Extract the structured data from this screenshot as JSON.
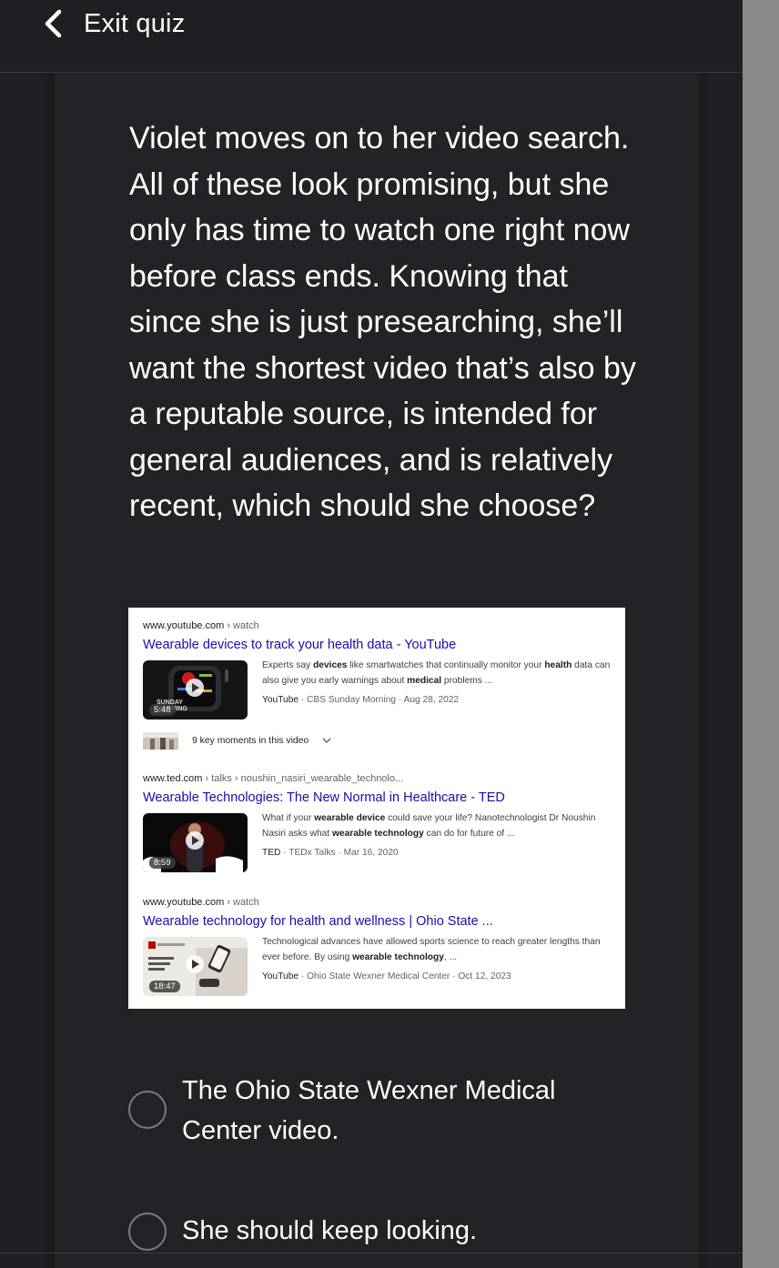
{
  "header": {
    "back_icon": "chevron-left-icon",
    "exit_label": "Exit quiz"
  },
  "question": {
    "text": "Violet moves on to her video search. All of these look promising, but she only has time to watch one right now before class ends. Knowing that since she is just presearching, she’ll want the shortest video that’s also by a reputable source, is intended for general audiences, and is relatively recent, which should she choose?"
  },
  "search_results": [
    {
      "domain": "www.youtube.com",
      "path": " › watch",
      "title": "Wearable devices to track your health data - YouTube",
      "snippet_parts": [
        [
          "Experts say ",
          false
        ],
        [
          "devices",
          true
        ],
        [
          " like smartwatches that continually monitor your ",
          false
        ],
        [
          "health",
          true
        ],
        [
          " data can also give you early warnings about ",
          false
        ],
        [
          "medical",
          true
        ],
        [
          " problems ...",
          false
        ]
      ],
      "source": "YouTube",
      "meta_rest": " · CBS Sunday Morning · Aug 28, 2022",
      "duration": "5:48",
      "moments_label": "9 key moments in this video"
    },
    {
      "domain": "www.ted.com",
      "path": " › talks › noushin_nasiri_wearable_technolo...",
      "title": "Wearable Technologies: The New Normal in Healthcare - TED",
      "snippet_parts": [
        [
          "What if your ",
          false
        ],
        [
          "wearable device",
          true
        ],
        [
          " could save your life? Nanotechnologist Dr Noushin Nasiri asks what ",
          false
        ],
        [
          "wearable technology",
          true
        ],
        [
          " can do for future of ...",
          false
        ]
      ],
      "source": "TED",
      "meta_rest": " · TEDx Talks · Mar 16, 2020",
      "duration": "8:59"
    },
    {
      "domain": "www.youtube.com",
      "path": " › watch",
      "title": "Wearable technology for health and wellness | Ohio State ...",
      "snippet_parts": [
        [
          "Technological advances have allowed sports science to reach greater lengths than ever before. By using ",
          false
        ],
        [
          "wearable technology",
          true
        ],
        [
          ", ...",
          false
        ]
      ],
      "source": "YouTube",
      "meta_rest": " · Ohio State Wexner Medical Center · Oct 12, 2023",
      "duration": "18:47"
    }
  ],
  "options": [
    {
      "label": "The Ohio State Wexner Medical Center video.",
      "selected": false
    },
    {
      "label": "She should keep looking.",
      "selected": false
    }
  ],
  "colors": {
    "background": "#1f1f23",
    "link": "#1a0dab",
    "scrollbar": "#8a8a8a"
  }
}
